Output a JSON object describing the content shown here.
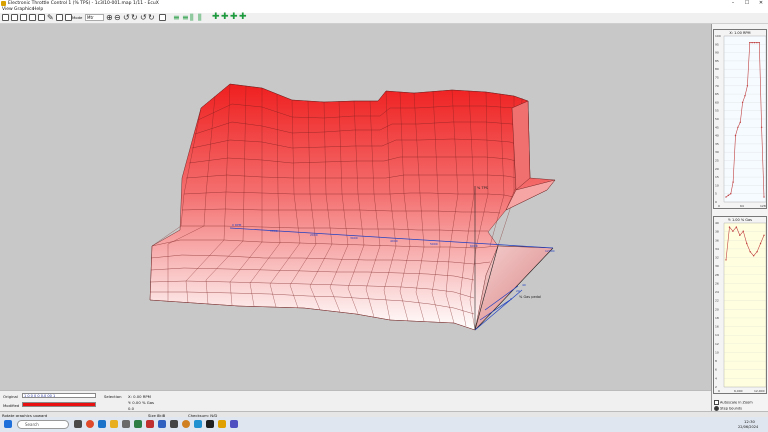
{
  "window": {
    "title": "Electronic Throttle Control 1 (% TPS) - 1c3l10-001.map 1/11 - EcuX",
    "controls": {
      "minimize": "–",
      "maximize": "☐",
      "close": "✕"
    }
  },
  "menu": [
    "View",
    "Graphics",
    "Help"
  ],
  "toolbar": {
    "mode_label": "Mode",
    "mode_value": "Mtr"
  },
  "viewport": {
    "bg_color": "#c8c8c8",
    "axis_labels": {
      "vertical": "% TPS",
      "right": "RPM",
      "depth": "% Gas pedal"
    },
    "surface_color_top": "#ef2020",
    "surface_color_bottom": "#ffffff"
  },
  "right_panel": {
    "graph1": {
      "title": "X: 1.00 RPM",
      "yticks": [
        "100",
        "95",
        "90",
        "85",
        "80",
        "75",
        "70",
        "65",
        "60",
        "55",
        "50",
        "45",
        "40",
        "35",
        "30",
        "25",
        "20",
        "15",
        "10",
        "5",
        "0"
      ],
      "xticks": [
        "0",
        "64",
        "128"
      ],
      "bg": "#f5fbff",
      "line_color": "#c04040",
      "data": [
        3,
        4,
        5,
        12,
        40,
        45,
        48,
        60,
        64,
        70,
        96,
        96,
        96,
        96,
        96,
        45,
        3
      ]
    },
    "graph2": {
      "title": "Y: 1.00 % Gas",
      "yticks": [
        "40",
        "38",
        "36",
        "34",
        "32",
        "30",
        "28",
        "26",
        "24",
        "22",
        "20",
        "18",
        "16",
        "14",
        "12",
        "10",
        "8",
        "6",
        "4",
        "2"
      ],
      "xticks": [
        "0",
        "6,000",
        "12,000"
      ],
      "bg": "#ffffe0",
      "line_color": "#c04040",
      "data": [
        31,
        39,
        38,
        39,
        37,
        38,
        35,
        33,
        32,
        33,
        35,
        37
      ]
    },
    "options": {
      "autoscale_label": "Autoscale in Zoom",
      "stepbounds_label": "Step bounds"
    }
  },
  "info": {
    "original_label": "Original",
    "original_value": "1 0 0 0 0 0.0 00 1",
    "modified_label": "Modified",
    "modified_color": "#e81010",
    "selection_label": "Selection",
    "selection_lines": [
      "X: 0.00 RPM",
      "Y: 0.00 % Gas",
      "0.0"
    ]
  },
  "status": {
    "left": "Rotate graphics upward",
    "size": "Size 8kiB",
    "checksum": "Checksum: N/D"
  },
  "taskbar": {
    "search_placeholder": "Search",
    "time": "12:30",
    "date": "22/06/2024"
  }
}
